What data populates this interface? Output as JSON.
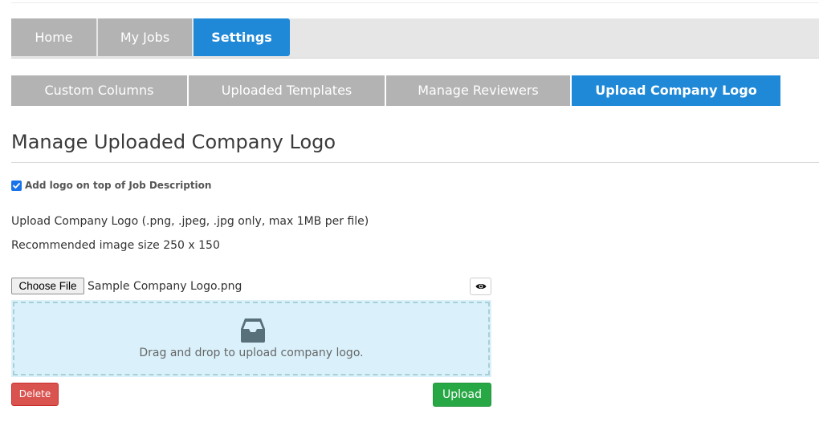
{
  "main_nav": {
    "tabs": [
      {
        "label": "Home",
        "active": false
      },
      {
        "label": "My Jobs",
        "active": false
      },
      {
        "label": "Settings",
        "active": true
      }
    ]
  },
  "sub_nav": {
    "tabs": [
      {
        "label": "Custom Columns",
        "active": false
      },
      {
        "label": "Uploaded Templates",
        "active": false
      },
      {
        "label": "Manage Reviewers",
        "active": false
      },
      {
        "label": "Upload Company Logo",
        "active": true
      }
    ]
  },
  "page": {
    "title": "Manage Uploaded Company Logo",
    "checkbox_label": "Add logo on top of Job Description",
    "checkbox_checked": true,
    "upload_info": "Upload Company Logo (.png, .jpeg, .jpg only, max 1MB per file)",
    "size_info": "Recommended image size 250 x 150"
  },
  "file_input": {
    "button_label": "Choose File",
    "file_name": "Sample Company Logo.png",
    "preview_icon": "eye-icon"
  },
  "dropzone": {
    "icon": "inbox-icon",
    "text": "Drag and drop to upload company logo."
  },
  "actions": {
    "delete_label": "Delete",
    "upload_label": "Upload"
  },
  "colors": {
    "active_tab": "#1f89d8",
    "inactive_tab": "#b3b3b3",
    "delete": "#d9534f",
    "upload": "#28a745",
    "dropzone_bg": "#daf1fb"
  }
}
